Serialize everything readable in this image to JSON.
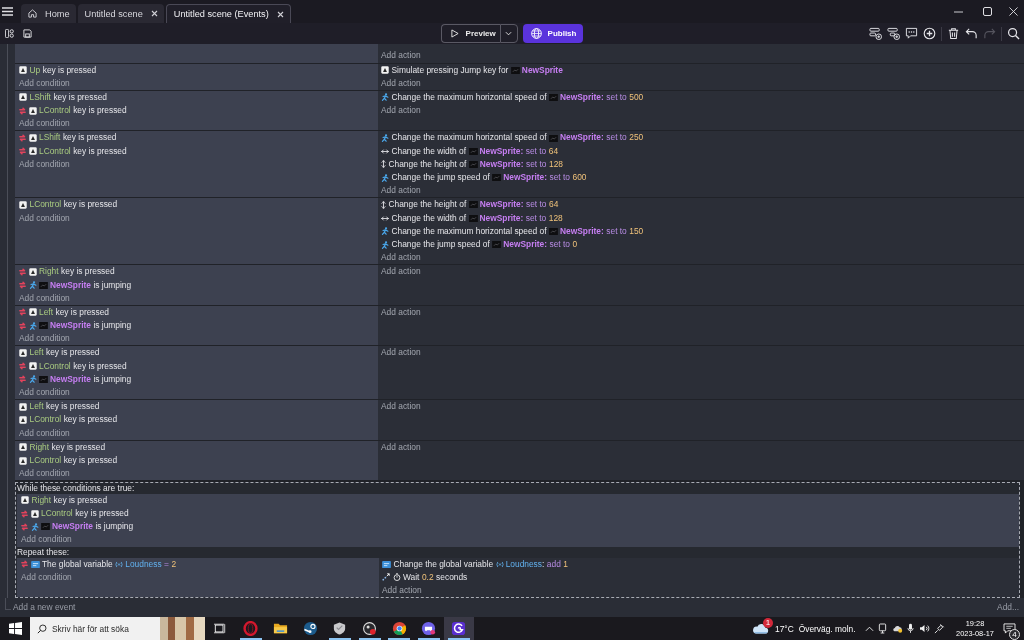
{
  "titlebar": {
    "tabs": [
      {
        "kind": "home",
        "label": "Home",
        "selected": false
      },
      {
        "kind": "document",
        "label": "Untitled scene",
        "selected": false
      },
      {
        "kind": "document",
        "label": "Untitled scene (Events)",
        "selected": true
      }
    ]
  },
  "toolbar": {
    "preview": "Preview",
    "publish": "Publish",
    "tool_groups": [
      [
        {
          "kind": "add_event",
          "disabled": false
        },
        {
          "kind": "add_subevent",
          "disabled": false
        },
        {
          "kind": "add_comment",
          "disabled": false
        },
        {
          "kind": "add_other",
          "disabled": false
        }
      ],
      [
        {
          "kind": "delete",
          "disabled": false
        },
        {
          "kind": "undo",
          "disabled": false
        },
        {
          "kind": "redo",
          "disabled": true
        }
      ],
      [
        {
          "kind": "search",
          "disabled": false
        }
      ]
    ]
  },
  "events": [
    {
      "kind": "standard",
      "add_action": "Add action"
    },
    {
      "kind": "standard",
      "conditions": [
        {
          "kind": "key",
          "inverted": false,
          "parts": [
            {
              "kind": "key",
              "text": "Up"
            },
            {
              "kind": "text",
              "text": "key is pressed"
            }
          ]
        }
      ],
      "add_condition": "Add condition",
      "actions": [
        {
          "kind": "key",
          "parts": [
            {
              "kind": "text",
              "text": "Simulate pressing Jump key for"
            },
            {
              "kind": "object",
              "text": "NewSprite"
            }
          ]
        }
      ],
      "add_action": "Add action"
    },
    {
      "kind": "standard",
      "conditions": [
        {
          "kind": "key",
          "inverted": false,
          "parts": [
            {
              "kind": "key",
              "text": "LShift"
            },
            {
              "kind": "text",
              "text": "key is pressed"
            }
          ]
        },
        {
          "kind": "key",
          "inverted": true,
          "parts": [
            {
              "kind": "key",
              "text": "LControl"
            },
            {
              "kind": "text",
              "text": "key is pressed"
            }
          ]
        }
      ],
      "add_condition": "Add condition",
      "actions": [
        {
          "kind": "platformer",
          "parts": [
            {
              "kind": "text",
              "text": "Change the maximum horizontal speed of"
            },
            {
              "kind": "object",
              "text": "NewSprite:"
            },
            {
              "kind": "op",
              "text": "set to"
            },
            {
              "kind": "num",
              "text": "500"
            }
          ]
        }
      ],
      "add_action": "Add action"
    },
    {
      "kind": "standard",
      "conditions": [
        {
          "kind": "key",
          "inverted": true,
          "parts": [
            {
              "kind": "key",
              "text": "LShift"
            },
            {
              "kind": "text",
              "text": "key is pressed"
            }
          ]
        },
        {
          "kind": "key",
          "inverted": true,
          "parts": [
            {
              "kind": "key",
              "text": "LControl"
            },
            {
              "kind": "text",
              "text": "key is pressed"
            }
          ]
        }
      ],
      "add_condition": "Add condition",
      "actions": [
        {
          "kind": "platformer",
          "parts": [
            {
              "kind": "text",
              "text": "Change the maximum horizontal speed of"
            },
            {
              "kind": "object",
              "text": "NewSprite:"
            },
            {
              "kind": "op",
              "text": "set to"
            },
            {
              "kind": "num",
              "text": "250"
            }
          ]
        },
        {
          "kind": "width",
          "parts": [
            {
              "kind": "text",
              "text": "Change the width of"
            },
            {
              "kind": "object",
              "text": "NewSprite:"
            },
            {
              "kind": "op",
              "text": "set to"
            },
            {
              "kind": "num",
              "text": "64"
            }
          ]
        },
        {
          "kind": "height",
          "parts": [
            {
              "kind": "text",
              "text": "Change the height of"
            },
            {
              "kind": "object",
              "text": "NewSprite:"
            },
            {
              "kind": "op",
              "text": "set to"
            },
            {
              "kind": "num",
              "text": "128"
            }
          ]
        },
        {
          "kind": "platformer",
          "parts": [
            {
              "kind": "text",
              "text": "Change the jump speed of"
            },
            {
              "kind": "object",
              "text": "NewSprite:"
            },
            {
              "kind": "op",
              "text": "set to"
            },
            {
              "kind": "num",
              "text": "600"
            }
          ]
        }
      ],
      "add_action": "Add action"
    },
    {
      "kind": "standard",
      "conditions": [
        {
          "kind": "key",
          "inverted": false,
          "parts": [
            {
              "kind": "key",
              "text": "LControl"
            },
            {
              "kind": "text",
              "text": "key is pressed"
            }
          ]
        }
      ],
      "add_condition": "Add condition",
      "actions": [
        {
          "kind": "height",
          "parts": [
            {
              "kind": "text",
              "text": "Change the height of"
            },
            {
              "kind": "object",
              "text": "NewSprite:"
            },
            {
              "kind": "op",
              "text": "set to"
            },
            {
              "kind": "num",
              "text": "64"
            }
          ]
        },
        {
          "kind": "width",
          "parts": [
            {
              "kind": "text",
              "text": "Change the width of"
            },
            {
              "kind": "object",
              "text": "NewSprite:"
            },
            {
              "kind": "op",
              "text": "set to"
            },
            {
              "kind": "num",
              "text": "128"
            }
          ]
        },
        {
          "kind": "platformer",
          "parts": [
            {
              "kind": "text",
              "text": "Change the maximum horizontal speed of"
            },
            {
              "kind": "object",
              "text": "NewSprite:"
            },
            {
              "kind": "op",
              "text": "set to"
            },
            {
              "kind": "num",
              "text": "150"
            }
          ]
        },
        {
          "kind": "platformer",
          "parts": [
            {
              "kind": "text",
              "text": "Change the jump speed of"
            },
            {
              "kind": "object",
              "text": "NewSprite:"
            },
            {
              "kind": "op",
              "text": "set to"
            },
            {
              "kind": "num",
              "text": "0"
            }
          ]
        }
      ],
      "add_action": "Add action"
    },
    {
      "kind": "standard",
      "conditions": [
        {
          "kind": "key",
          "inverted": true,
          "parts": [
            {
              "kind": "key",
              "text": "Right"
            },
            {
              "kind": "text",
              "text": "key is pressed"
            }
          ]
        },
        {
          "kind": "platformer",
          "inverted": true,
          "parts": [
            {
              "kind": "object",
              "text": "NewSprite"
            },
            {
              "kind": "text",
              "text": "is jumping"
            }
          ]
        }
      ],
      "add_condition": "Add condition",
      "add_action": "Add action"
    },
    {
      "kind": "standard",
      "conditions": [
        {
          "kind": "key",
          "inverted": true,
          "parts": [
            {
              "kind": "key",
              "text": "Left"
            },
            {
              "kind": "text",
              "text": "key is pressed"
            }
          ]
        },
        {
          "kind": "platformer",
          "inverted": true,
          "parts": [
            {
              "kind": "object",
              "text": "NewSprite"
            },
            {
              "kind": "text",
              "text": "is jumping"
            }
          ]
        }
      ],
      "add_condition": "Add condition",
      "add_action": "Add action"
    },
    {
      "kind": "standard",
      "conditions": [
        {
          "kind": "key",
          "inverted": false,
          "parts": [
            {
              "kind": "key",
              "text": "Left"
            },
            {
              "kind": "text",
              "text": "key is pressed"
            }
          ]
        },
        {
          "kind": "key",
          "inverted": true,
          "parts": [
            {
              "kind": "key",
              "text": "LControl"
            },
            {
              "kind": "text",
              "text": "key is pressed"
            }
          ]
        },
        {
          "kind": "platformer",
          "inverted": true,
          "parts": [
            {
              "kind": "object",
              "text": "NewSprite"
            },
            {
              "kind": "text",
              "text": "is jumping"
            }
          ]
        }
      ],
      "add_condition": "Add condition",
      "add_action": "Add action"
    },
    {
      "kind": "standard",
      "conditions": [
        {
          "kind": "key",
          "inverted": false,
          "parts": [
            {
              "kind": "key",
              "text": "Left"
            },
            {
              "kind": "text",
              "text": "key is pressed"
            }
          ]
        },
        {
          "kind": "key",
          "inverted": false,
          "parts": [
            {
              "kind": "key",
              "text": "LControl"
            },
            {
              "kind": "text",
              "text": "key is pressed"
            }
          ]
        }
      ],
      "add_condition": "Add condition",
      "add_action": "Add action"
    },
    {
      "kind": "standard",
      "conditions": [
        {
          "kind": "key",
          "inverted": false,
          "parts": [
            {
              "kind": "key",
              "text": "Right"
            },
            {
              "kind": "text",
              "text": "key is pressed"
            }
          ]
        },
        {
          "kind": "key",
          "inverted": false,
          "parts": [
            {
              "kind": "key",
              "text": "LControl"
            },
            {
              "kind": "text",
              "text": "key is pressed"
            }
          ]
        }
      ],
      "add_condition": "Add condition",
      "add_action": "Add action"
    },
    {
      "kind": "while",
      "while_header": "While these conditions are true:",
      "while_conditions": [
        {
          "kind": "key",
          "inverted": false,
          "parts": [
            {
              "kind": "key",
              "text": "Right"
            },
            {
              "kind": "text",
              "text": "key is pressed"
            }
          ]
        },
        {
          "kind": "key",
          "inverted": true,
          "parts": [
            {
              "kind": "key",
              "text": "LControl"
            },
            {
              "kind": "text",
              "text": "key is pressed"
            }
          ]
        },
        {
          "kind": "platformer",
          "inverted": true,
          "parts": [
            {
              "kind": "object",
              "text": "NewSprite"
            },
            {
              "kind": "text",
              "text": "is jumping"
            }
          ]
        }
      ],
      "add_while_condition": "Add condition",
      "repeat_header": "Repeat these:",
      "conditions": [
        {
          "kind": "variable",
          "inverted": true,
          "parts": [
            {
              "kind": "text",
              "text": "The global variable"
            },
            {
              "kind": "variable",
              "text": "Loudness"
            },
            {
              "kind": "op",
              "text": "="
            },
            {
              "kind": "num",
              "text": "2"
            }
          ]
        }
      ],
      "add_condition": "Add condition",
      "actions": [
        {
          "kind": "variable",
          "parts": [
            {
              "kind": "text",
              "text": "Change the global variable"
            },
            {
              "kind": "variable",
              "text": "Loudness"
            },
            {
              "kind": "punct",
              "text": ":"
            },
            {
              "kind": "op",
              "text": "add"
            },
            {
              "kind": "num",
              "text": "1"
            }
          ]
        },
        {
          "kind": "wait",
          "parts": [
            {
              "kind": "text",
              "text": "Wait"
            },
            {
              "kind": "num",
              "text": "0.2"
            },
            {
              "kind": "text",
              "text": "seconds"
            }
          ]
        }
      ],
      "add_action": "Add action"
    }
  ],
  "footer": {
    "add_event": "Add a new event",
    "add_other": "Add..."
  },
  "taskbar": {
    "search": {
      "placeholder": "Skriv här för att söka"
    },
    "apps": [
      {
        "kind": "ring",
        "running": true,
        "selected": false
      },
      {
        "kind": "folder",
        "running": false,
        "selected": false
      },
      {
        "kind": "disc",
        "running": false,
        "selected": false
      },
      {
        "kind": "shield",
        "running": true,
        "selected": false
      },
      {
        "kind": "record",
        "running": true,
        "selected": false
      },
      {
        "kind": "wheel",
        "running": true,
        "selected": false
      },
      {
        "kind": "gamepad",
        "running": true,
        "selected": false
      },
      {
        "kind": "spiral",
        "running": true,
        "selected": true
      }
    ],
    "weather": {
      "badge": "1",
      "temperature": "17°C",
      "condition": "Överväg. moln."
    },
    "clock": {
      "time": "19:28",
      "date": "2023-08-17"
    },
    "notifications": {
      "count": "4"
    }
  }
}
